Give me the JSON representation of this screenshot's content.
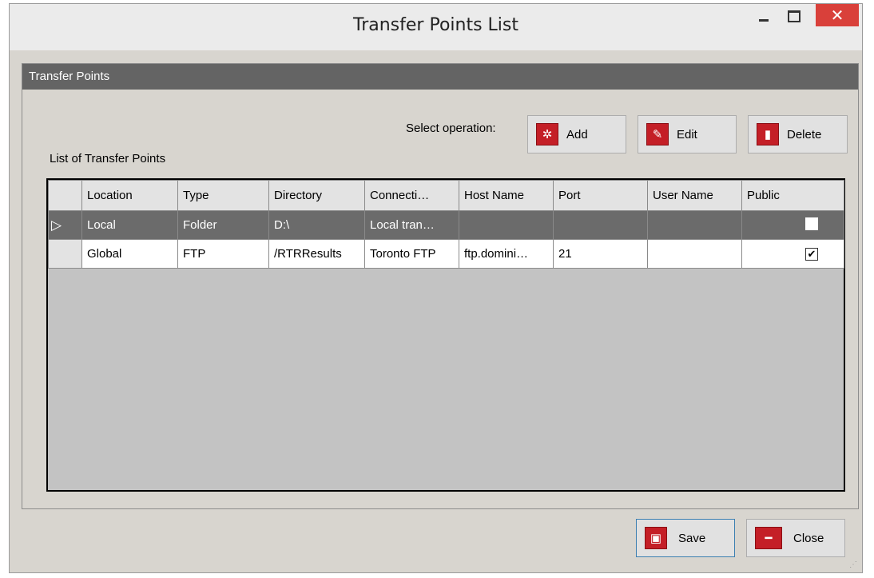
{
  "window": {
    "title": "Transfer Points List"
  },
  "group": {
    "title": "Transfer Points"
  },
  "toolbar": {
    "select_label": "Select operation:",
    "add_label": "Add",
    "edit_label": "Edit",
    "delete_label": "Delete",
    "add_icon": "gear-icon",
    "edit_icon": "edit-icon",
    "delete_icon": "trash-icon"
  },
  "list": {
    "label": "List of Transfer Points",
    "columns": [
      "Location",
      "Type",
      "Directory",
      "Connecti…",
      "Host Name",
      "Port",
      "User Name",
      "Public"
    ],
    "rows": [
      {
        "location": "Local",
        "type": "Folder",
        "directory": "D:\\",
        "connection": "Local tran…",
        "host": "",
        "port": "",
        "user": "",
        "public": false,
        "selected": true
      },
      {
        "location": "Global",
        "type": "FTP",
        "directory": "/RTRResults",
        "connection": "Toronto FTP",
        "host": "ftp.domini…",
        "port": "21",
        "user": "",
        "public": true,
        "selected": false
      }
    ]
  },
  "footer": {
    "save_label": "Save",
    "close_label": "Close"
  },
  "colors": {
    "accent": "#c41f27",
    "selected_row": "#6b6b6b",
    "header_bar": "#646464",
    "close_button": "#d9403a"
  }
}
